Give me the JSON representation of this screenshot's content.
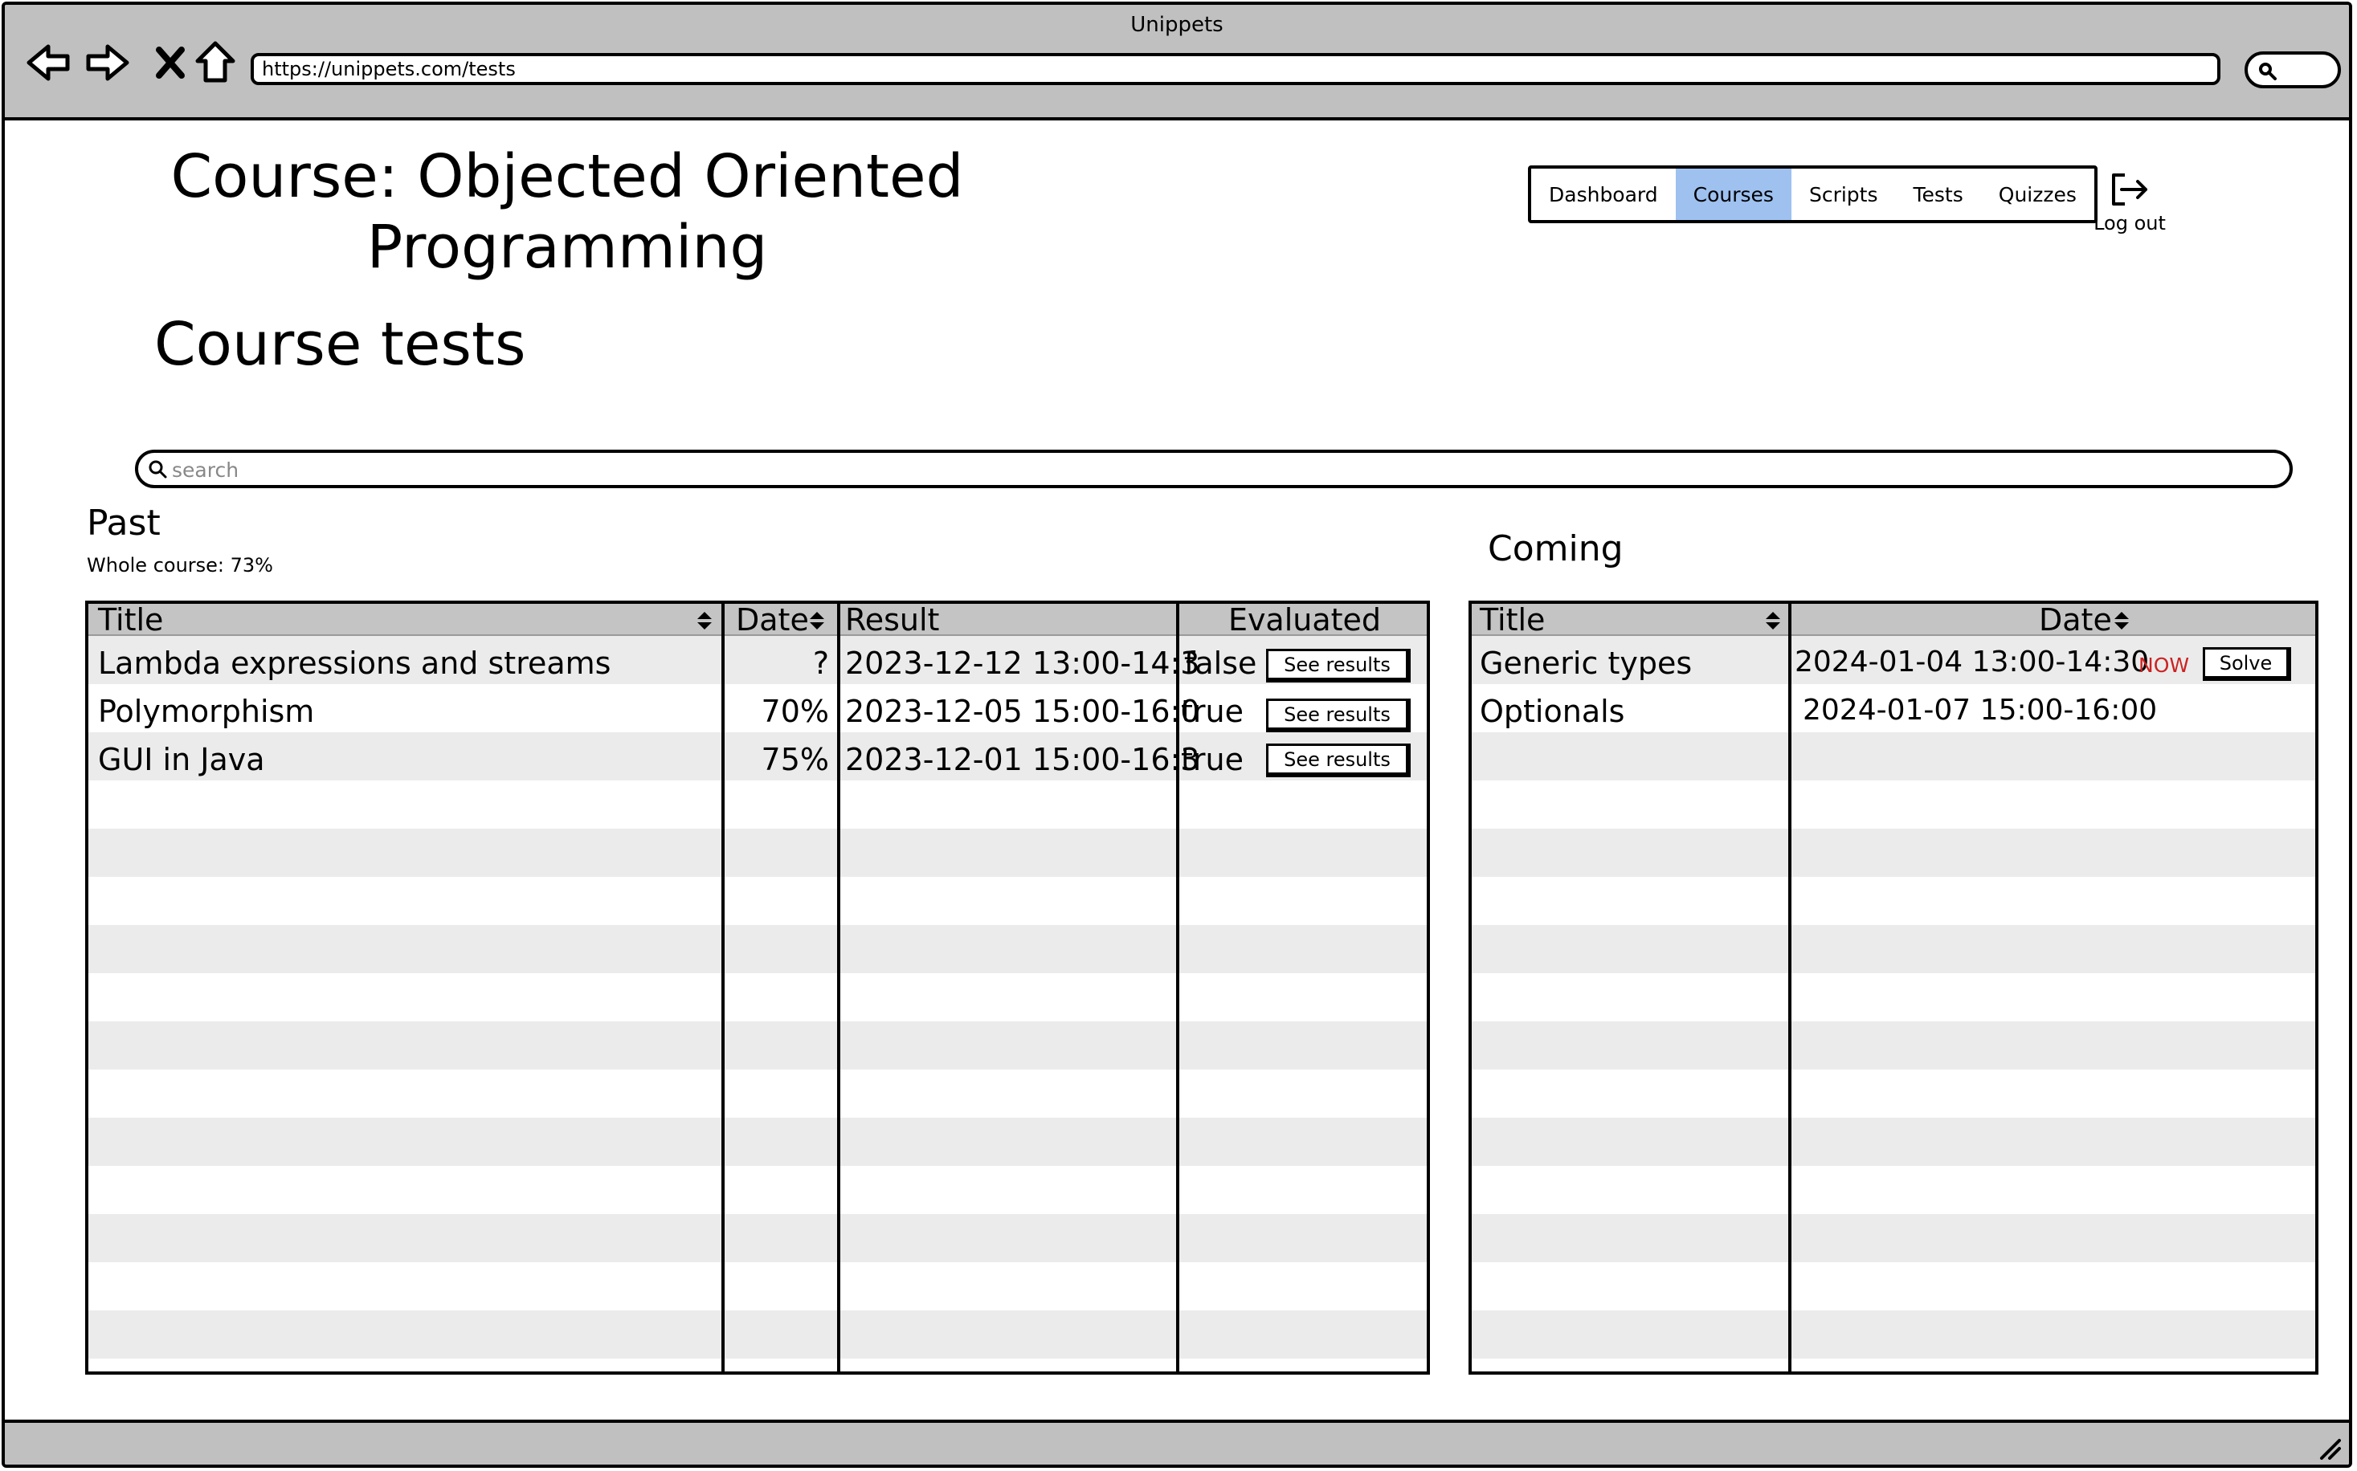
{
  "window": {
    "title": "Unippets"
  },
  "browser": {
    "url": "https://unippets.com/tests"
  },
  "page": {
    "title": "Course: Objected Oriented Programming",
    "section_title": "Course tests"
  },
  "nav": {
    "tabs": [
      "Dashboard",
      "Courses",
      "Scripts",
      "Tests",
      "Quizzes"
    ],
    "active": "Courses",
    "logout_label": "Log out"
  },
  "search": {
    "placeholder": "search",
    "value": ""
  },
  "past": {
    "label": "Past",
    "summary": "Whole course: 73%",
    "columns": [
      "Title",
      "Date",
      "Result",
      "Evaluated"
    ],
    "rows": [
      {
        "title": "Lambda expressions and streams",
        "score": "?",
        "date": "2023-12-12 13:00-14:3",
        "evaluated": "false",
        "action": "See results"
      },
      {
        "title": "Polymorphism",
        "score": "70%",
        "date": "2023-12-05 15:00-16:0",
        "evaluated": "true",
        "action": "See results"
      },
      {
        "title": "GUI in Java",
        "score": "75%",
        "date": "2023-12-01 15:00-16:3",
        "evaluated": "true",
        "action": "See results"
      }
    ]
  },
  "coming": {
    "label": "Coming",
    "columns": [
      "Title",
      "Date"
    ],
    "rows": [
      {
        "title": "Generic types",
        "date": "2024-01-04 13:00-14:30",
        "badge": "NOW",
        "action": "Solve"
      },
      {
        "title": "Optionals",
        "date": "2024-01-07 15:00-16:00"
      }
    ]
  },
  "colors": {
    "active_tab": "#9ec1f0",
    "now_badge": "#cc2222",
    "row_alt": "#ebebeb",
    "header": "#c4c4c4",
    "chrome": "#c0c0c0"
  }
}
